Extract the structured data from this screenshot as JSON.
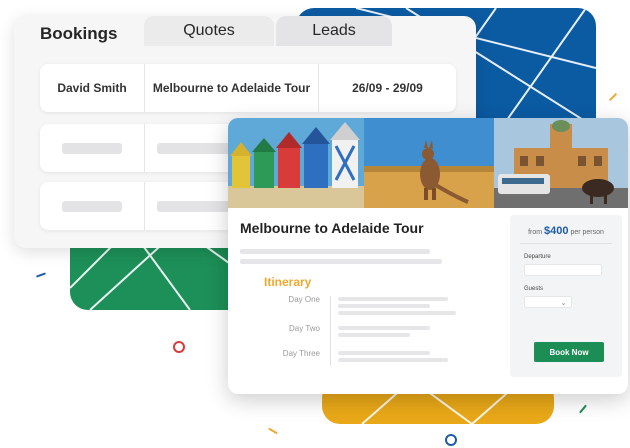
{
  "colors": {
    "blue_tile": "#0b5ba3",
    "green_tile": "#1d8f58",
    "yellow_tile": "#e8a818",
    "itinerary_accent": "#f0a830",
    "price_accent": "#1f5da8",
    "book_button": "#1d8d56"
  },
  "bookings": {
    "tabs": [
      {
        "label": "Bookings",
        "active": true
      },
      {
        "label": "Quotes",
        "active": false
      },
      {
        "label": "Leads",
        "active": false
      }
    ],
    "rows": [
      {
        "name": "David Smith",
        "tour": "Melbourne to Adelaide Tour",
        "dates": "26/09 - 29/09"
      }
    ]
  },
  "tour": {
    "photos": [
      "beach-huts-photo",
      "kangaroo-photo",
      "flinders-street-station-photo"
    ],
    "title": "Melbourne to Adelaide Tour",
    "itinerary": {
      "heading": "Itinerary",
      "days": [
        "Day One",
        "Day Two",
        "Day Three"
      ]
    },
    "booking": {
      "price_prefix": "from",
      "price": "$400",
      "price_suffix": "per person",
      "departure_label": "Departure",
      "guests_label": "Guests",
      "button_label": "Book Now"
    }
  }
}
